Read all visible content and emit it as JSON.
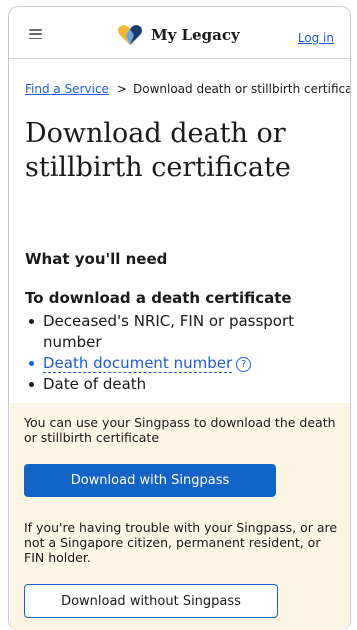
{
  "header": {
    "menu_icon": "hamburger-menu-icon",
    "logo_icon": "heart-logo-icon",
    "brand_name": "My Legacy",
    "login_label": "Log in",
    "colors": {
      "logo_dark": "#1b3a6b",
      "logo_gold": "#f2b53a",
      "logo_blue": "#6fa8dc"
    }
  },
  "breadcrumb": {
    "link_label": "Find a Service",
    "separator": ">",
    "current": "Download death or stillbirth certificate"
  },
  "page_title": "Download death or stillbirth certificate",
  "section_heading": "What you'll need",
  "death_cert": {
    "heading": "To download a death certificate",
    "items": [
      "Deceased's NRIC, FIN or passport number",
      "Death document number",
      "Date of death"
    ],
    "help_icon": "question-circle-icon",
    "help_glyph": "?"
  },
  "panel": {
    "background": "#fdf5e3",
    "singpass_text": "You can use your Singpass to download the death or stillbirth certificate",
    "singpass_button": "Download with Singpass",
    "no_singpass_text": "If you're having trouble with your Singpass, or are not a Singapore citizen, permanent resident, or FIN holder.",
    "no_singpass_button": "Download without Singpass"
  },
  "colors": {
    "link": "#1f5bd8",
    "primary": "#1464c8"
  }
}
